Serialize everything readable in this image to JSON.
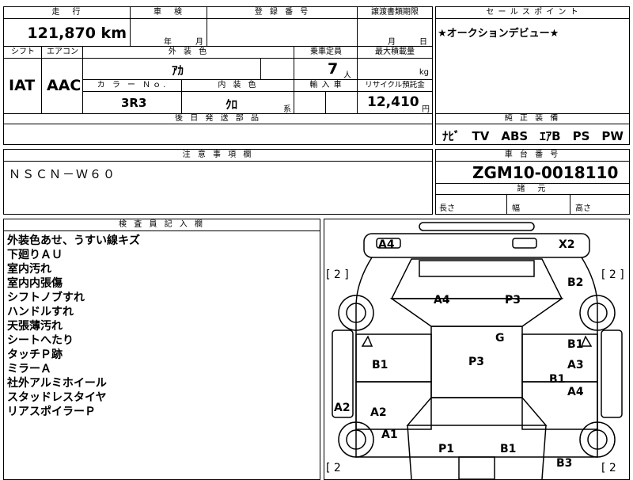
{
  "vehicle": {
    "mileage_label": "走　行",
    "mileage": "121,870 km",
    "inspection_label": "車　検",
    "inspection_year": "年",
    "inspection_month": "月",
    "reg_label": "登 録 番 号",
    "transfer_label": "譲渡書類期限",
    "transfer_month": "月",
    "transfer_day": "日",
    "shift_label": "シフト",
    "aircon_label": "エアコン",
    "shift": "IAT",
    "aircon": "AAC",
    "exterior_label": "外 装 色",
    "exterior": "ｱｶ",
    "capacity_label": "乗車定員",
    "capacity": "7",
    "capacity_unit": "人",
    "max_load_label": "最大積載量",
    "max_load_unit": "kg",
    "color_no_label": "カ ラ ー Ｎｏ.",
    "color_no": "3R3",
    "interior_label": "内 装 色",
    "interior": "ｸﾛ",
    "interior_unit": "系",
    "import_label": "輸 入 車",
    "recycle_label": "リサイクル預託金",
    "recycle": "12,410",
    "recycle_unit": "円",
    "later_parts_label": "後 日 発 送 部 品"
  },
  "sales_point": {
    "label": "セ ー ル ス ポ イ ン ト",
    "text": "★オークションデビュー★"
  },
  "equipment": {
    "label": "純 正 装 備",
    "text": "ﾅﾋﾞ　TV　ABS　ｴｱB　PS　PW"
  },
  "caution": {
    "label": "注 意 事 項 欄",
    "text": "ＮＳＣＮ－Ｗ６０"
  },
  "chassis": {
    "label": "車 台 番 号",
    "value": "ZGM10-0018110",
    "spec_label": "諸　元",
    "length": "長さ",
    "width": "幅",
    "height": "高さ"
  },
  "inspector": {
    "label": "検 査 員 記 入 欄",
    "notes": [
      "外装色あせ、うすい線キズ",
      "下廻りＡＵ",
      "室内汚れ",
      "室内内張傷",
      "シフトノブすれ",
      "ハンドルすれ",
      "天張薄汚れ",
      "シートへたり",
      "タッチＰ跡",
      "ミラーＡ",
      "社外アルミホイール",
      "スタッドレスタイヤ",
      "リアスポイラーＰ"
    ]
  },
  "diagram": {
    "marks": [
      "A4",
      "X2",
      "[ 2 ]",
      "[ 2 ]",
      "B2",
      "A4",
      "P3",
      "G",
      "B1",
      "B1",
      "P3",
      "A3",
      "B1",
      "A4",
      "A2",
      "A2",
      "A1",
      "P1",
      "B1",
      "B3",
      "[ 2",
      "[ 2"
    ]
  }
}
